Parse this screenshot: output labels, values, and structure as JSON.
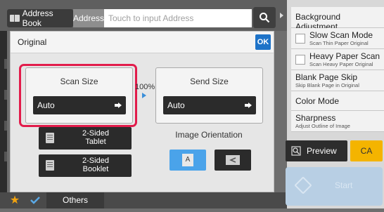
{
  "header": {
    "address_book_label": "Address Book",
    "address_label": "Address",
    "address_placeholder": "Touch to input Address"
  },
  "dialog": {
    "title": "Original",
    "ok_label": "OK",
    "scan_size": {
      "title": "Scan Size",
      "value": "Auto"
    },
    "ratio": "100%",
    "send_size": {
      "title": "Send Size",
      "value": "Auto"
    },
    "two_sided_tablet": {
      "line1": "2-Sided",
      "line2": "Tablet"
    },
    "two_sided_booklet": {
      "line1": "2-Sided",
      "line2": "Booklet"
    },
    "orientation": {
      "title": "Image Orientation",
      "portrait_glyph": "A",
      "selected": "portrait"
    }
  },
  "bottom": {
    "others_label": "Others"
  },
  "right_panel": {
    "items": [
      {
        "label": "Background Adjustment"
      },
      {
        "label": "Slow Scan Mode",
        "sub": "Scan Thin Paper Original",
        "checked": false
      },
      {
        "label": "Heavy Paper Scan",
        "sub": "Scan Heavy Paper Original",
        "checked": false
      },
      {
        "label": "Blank Page Skip",
        "sub": "Skip Blank Page in Original"
      },
      {
        "label": "Color Mode"
      },
      {
        "label": "Sharpness",
        "sub": "Adjust Outline of Image"
      }
    ],
    "preview_label": "Preview",
    "ca_label": "CA",
    "start_label": "Start"
  },
  "colors": {
    "accent_blue": "#1e73c8",
    "highlight_red": "#e21c4b",
    "ca_yellow": "#f4b400",
    "selected_orientation": "#4aa3ea"
  }
}
